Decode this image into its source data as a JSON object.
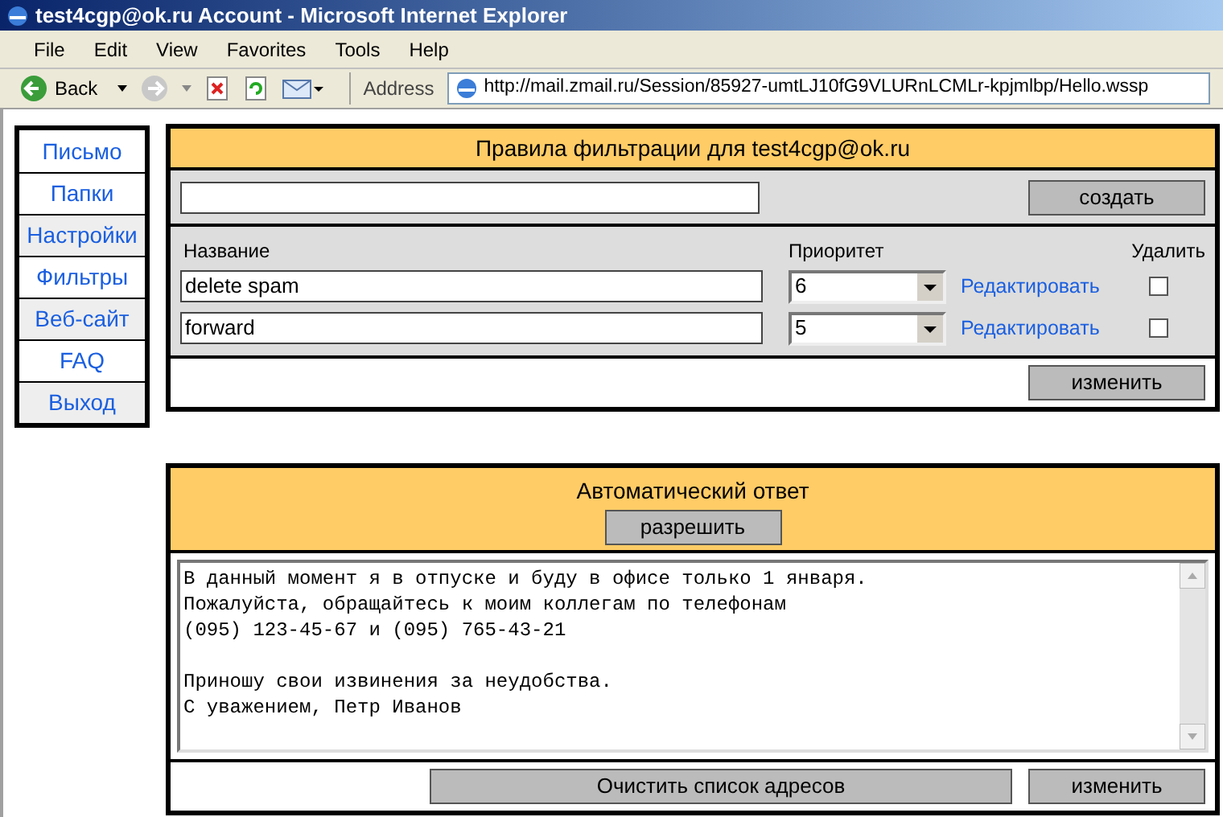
{
  "window": {
    "title": "test4cgp@ok.ru Account - Microsoft Internet Explorer"
  },
  "menu": [
    "File",
    "Edit",
    "View",
    "Favorites",
    "Tools",
    "Help"
  ],
  "toolbar": {
    "back": "Back",
    "address_label": "Address",
    "address": "http://mail.zmail.ru/Session/85927-umtLJ10fG9VLURnLCMLr-kpjmlbp/Hello.wssp"
  },
  "sidebar": {
    "items": [
      {
        "label": "Письмо",
        "shaded": false
      },
      {
        "label": "Папки",
        "shaded": false
      },
      {
        "label": "Настройки",
        "shaded": true
      },
      {
        "label": "Фильтры",
        "shaded": false
      },
      {
        "label": "Веб-сайт",
        "shaded": true
      },
      {
        "label": "FAQ",
        "shaded": false
      },
      {
        "label": "Выход",
        "shaded": true
      }
    ]
  },
  "filters": {
    "title": "Правила фильтрации для test4cgp@ok.ru",
    "create_button": "создать",
    "columns": [
      "Название",
      "Приоритет",
      "Удалить"
    ],
    "rows": [
      {
        "name": "delete spam",
        "priority": "6",
        "edit_link": "Редактировать",
        "checked": false
      },
      {
        "name": "forward",
        "priority": "5",
        "edit_link": "Редактировать",
        "checked": false
      }
    ],
    "update_button": "изменить"
  },
  "autoreply": {
    "title": "Автоматический ответ",
    "enable_button": "разрешить",
    "message": "В данный момент я в отпуске и буду в офисе только 1 января.\nПожалуйста, обращайтесь к моим коллегам по телефонам\n(095) 123-45-67 и (095) 765-43-21\n\nПриношу свои извинения за неудобства.\nС уважением, Петр Иванов",
    "clear_button": "Очистить список адресов",
    "update_button": "изменить"
  }
}
